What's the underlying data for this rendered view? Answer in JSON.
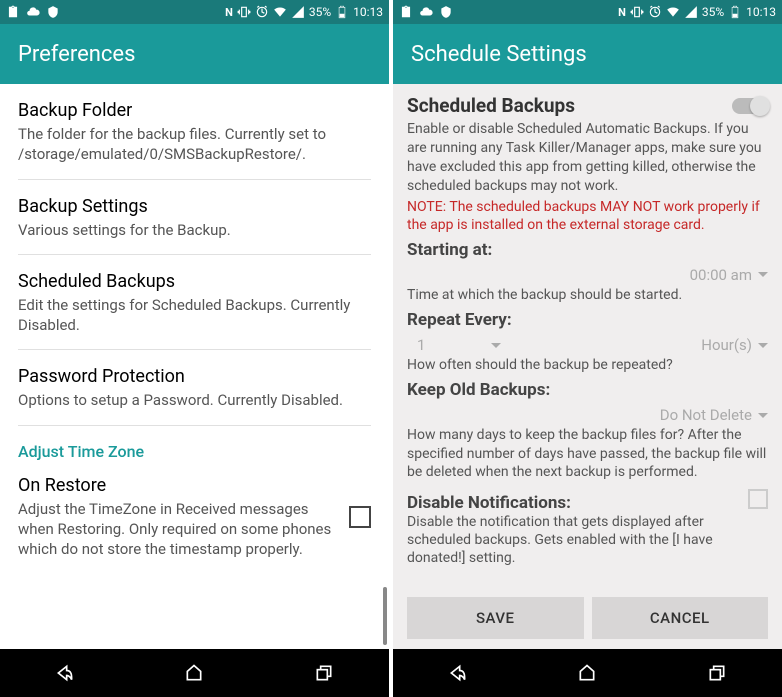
{
  "status": {
    "battery": "35%",
    "time": "10:13"
  },
  "left": {
    "title": "Preferences",
    "items": [
      {
        "title": "Backup Folder",
        "summary": "The folder for the backup files. Currently set to /storage/emulated/0/SMSBackupRestore/."
      },
      {
        "title": "Backup Settings",
        "summary": "Various settings for the Backup."
      },
      {
        "title": "Scheduled Backups",
        "summary": "Edit the settings for Scheduled Backups. Currently Disabled."
      },
      {
        "title": "Password Protection",
        "summary": "Options to setup a Password. Currently Disabled."
      }
    ],
    "category": "Adjust Time Zone",
    "onrestore": {
      "title": "On Restore",
      "summary": "Adjust the TimeZone in Received messages when Restoring. Only required on some phones which do not store the timestamp properly."
    }
  },
  "right": {
    "title": "Schedule Settings",
    "scheduled_backups": {
      "title": "Scheduled Backups",
      "desc": "Enable or disable Scheduled Automatic Backups. If you are running any Task Killer/Manager apps, make sure you have excluded this app from getting killed, otherwise the scheduled backups may not work.",
      "note": "NOTE: The scheduled backups MAY NOT work properly if the app is installed on the external storage card."
    },
    "starting_at": {
      "label": "Starting at:",
      "value": "00:00 am",
      "helper": "Time at which the backup should be started."
    },
    "repeat": {
      "label": "Repeat Every:",
      "count": "1",
      "unit": "Hour(s)",
      "helper": "How often should the backup be repeated?"
    },
    "keep": {
      "label": "Keep Old Backups:",
      "value": "Do Not Delete",
      "helper": "How many days to keep the backup files for? After the specified number of days have passed, the backup file will be deleted when the next backup is performed."
    },
    "notif": {
      "label": "Disable Notifications:",
      "helper": "Disable the notification that gets displayed after scheduled backups. Gets enabled with the [I have donated!] setting."
    },
    "buttons": {
      "save": "SAVE",
      "cancel": "CANCEL"
    }
  }
}
